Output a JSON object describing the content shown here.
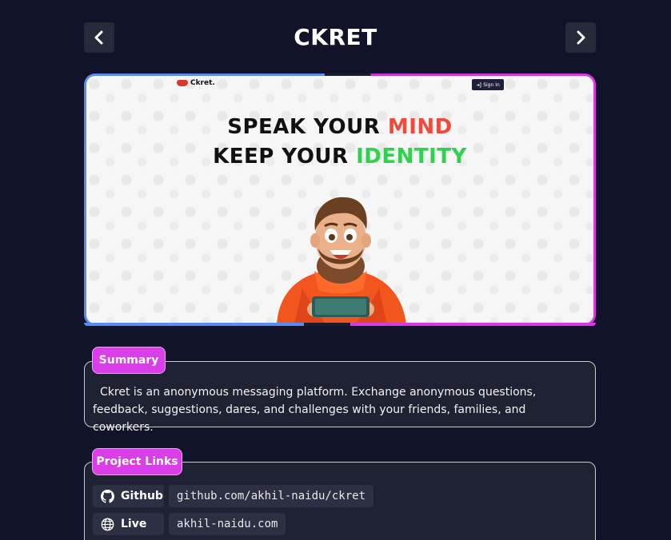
{
  "header": {
    "title": "CKRET",
    "prev_icon": "chevron-left-icon",
    "next_icon": "chevron-right-icon"
  },
  "preview": {
    "logo_text": "Ckret.",
    "signin_label": "Sign In",
    "headline_line1_prefix": "SPEAK YOUR ",
    "headline_line1_highlight": "MIND",
    "headline_line2_prefix": "KEEP YOUR ",
    "headline_line2_highlight": "IDENTITY",
    "highlight_colors": {
      "mind": "#f04a3c",
      "identity": "#2fd24c"
    }
  },
  "summary": {
    "badge": "Summary",
    "text": "Ckret is an anonymous messaging platform. Exchange anonymous questions, feedback, suggestions, dares, and challenges with your friends, families, and coworkers."
  },
  "links": {
    "badge": "Project Links",
    "items": [
      {
        "label": "Github",
        "icon": "github-icon",
        "url": "github.com/akhil-naidu/ckret"
      },
      {
        "label": "Live",
        "icon": "globe-icon",
        "url": "akhil-naidu.com"
      }
    ]
  },
  "colors": {
    "background": "#10132a",
    "accent": "#d93ee8",
    "card": "#1f2232"
  }
}
